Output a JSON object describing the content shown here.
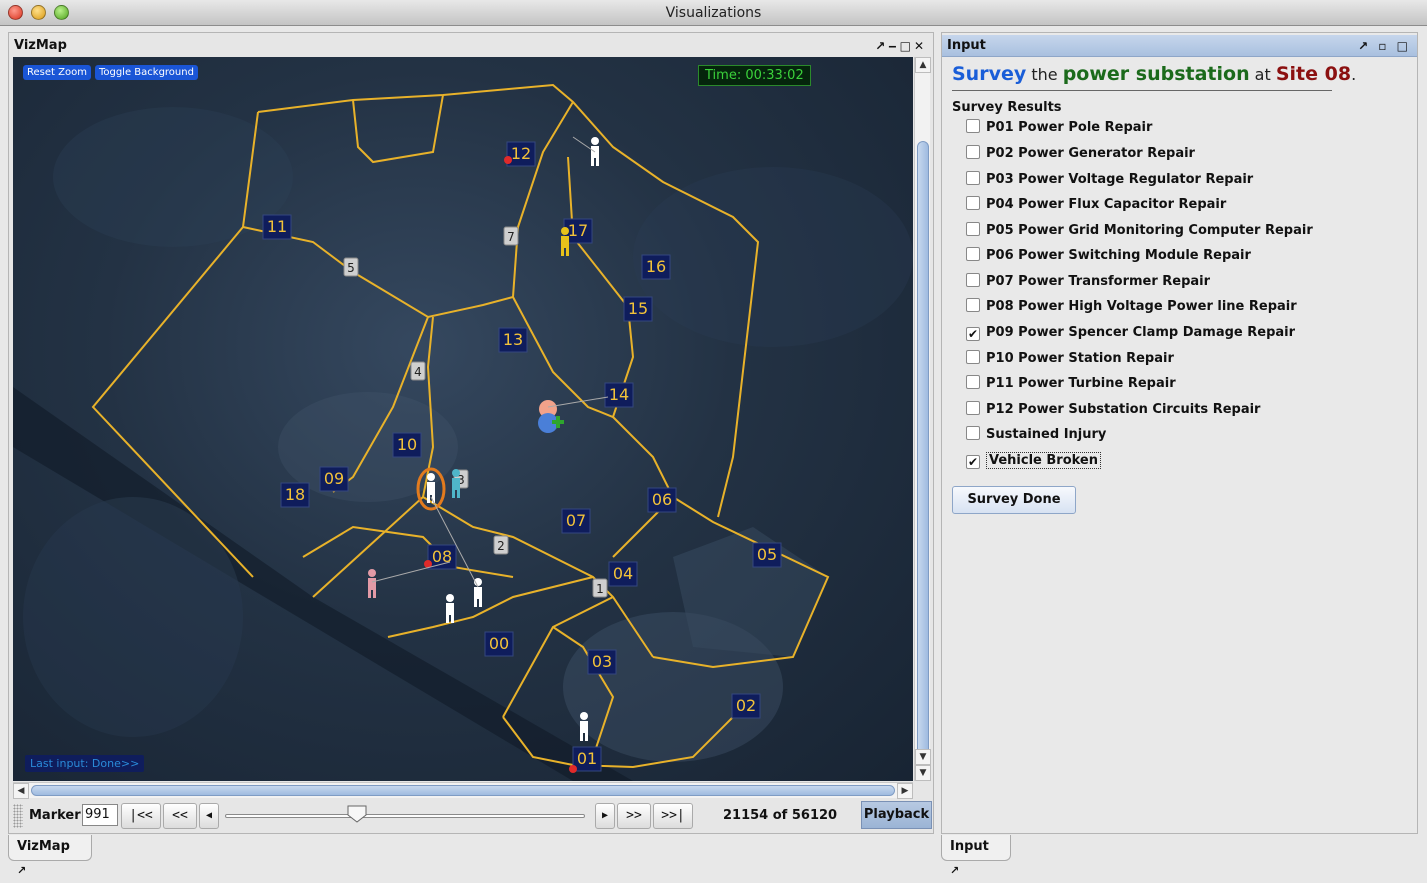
{
  "window": {
    "title": "Visualizations"
  },
  "vizmap": {
    "header": "VizMap",
    "header_icons": "↗‒□✕",
    "buttons": {
      "reset_zoom": "Reset Zoom",
      "toggle_background": "Toggle Background"
    },
    "timer": "Time: 00:33:02",
    "last_input": "Last input: Done>>",
    "sites": [
      {
        "id": "00"
      },
      {
        "id": "01"
      },
      {
        "id": "02"
      },
      {
        "id": "03"
      },
      {
        "id": "04"
      },
      {
        "id": "05"
      },
      {
        "id": "06"
      },
      {
        "id": "07"
      },
      {
        "id": "08"
      },
      {
        "id": "09"
      },
      {
        "id": "10"
      },
      {
        "id": "11"
      },
      {
        "id": "12"
      },
      {
        "id": "13"
      },
      {
        "id": "14"
      },
      {
        "id": "15"
      },
      {
        "id": "16"
      },
      {
        "id": "17"
      },
      {
        "id": "18"
      }
    ],
    "waypoints": [
      "1",
      "2",
      "3",
      "4",
      "5",
      "7"
    ],
    "controls": {
      "marker_label": "Marker:",
      "marker_value": "991",
      "first": "|<<",
      "prev": "<<",
      "next": ">>",
      "last": ">>|",
      "counter": "21154 of 56120",
      "playback": "Playback"
    },
    "tab": "VizMap"
  },
  "input": {
    "header": "Input",
    "heading": {
      "verb": "Survey",
      "w1": " the ",
      "object": "power substation",
      "w2": " at ",
      "site": "Site 08",
      "w3": "."
    },
    "results_title": "Survey Results",
    "results": [
      {
        "label": "P01 Power Pole Repair",
        "checked": false
      },
      {
        "label": "P02 Power Generator Repair",
        "checked": false
      },
      {
        "label": "P03 Power Voltage Regulator Repair",
        "checked": false
      },
      {
        "label": "P04 Power Flux Capacitor Repair",
        "checked": false
      },
      {
        "label": "P05 Power Grid Monitoring Computer Repair",
        "checked": false
      },
      {
        "label": "P06 Power Switching Module Repair",
        "checked": false
      },
      {
        "label": "P07 Power Transformer Repair",
        "checked": false
      },
      {
        "label": "P08 Power High Voltage Power line Repair",
        "checked": false
      },
      {
        "label": "P09 Power Spencer Clamp Damage Repair",
        "checked": true
      },
      {
        "label": "P10 Power Station Repair",
        "checked": false
      },
      {
        "label": "P11 Power Turbine Repair",
        "checked": false
      },
      {
        "label": "P12 Power Substation Circuits Repair",
        "checked": false
      },
      {
        "label": "Sustained Injury",
        "checked": false
      },
      {
        "label": "Vehicle Broken",
        "checked": true
      }
    ],
    "done_button": "Survey Done",
    "tab": "Input"
  },
  "colors": {
    "path": "#e8b22a",
    "site_label": "#f2c23a",
    "site_bg": "#0f1d5c",
    "accent": "#1a5ed8"
  }
}
